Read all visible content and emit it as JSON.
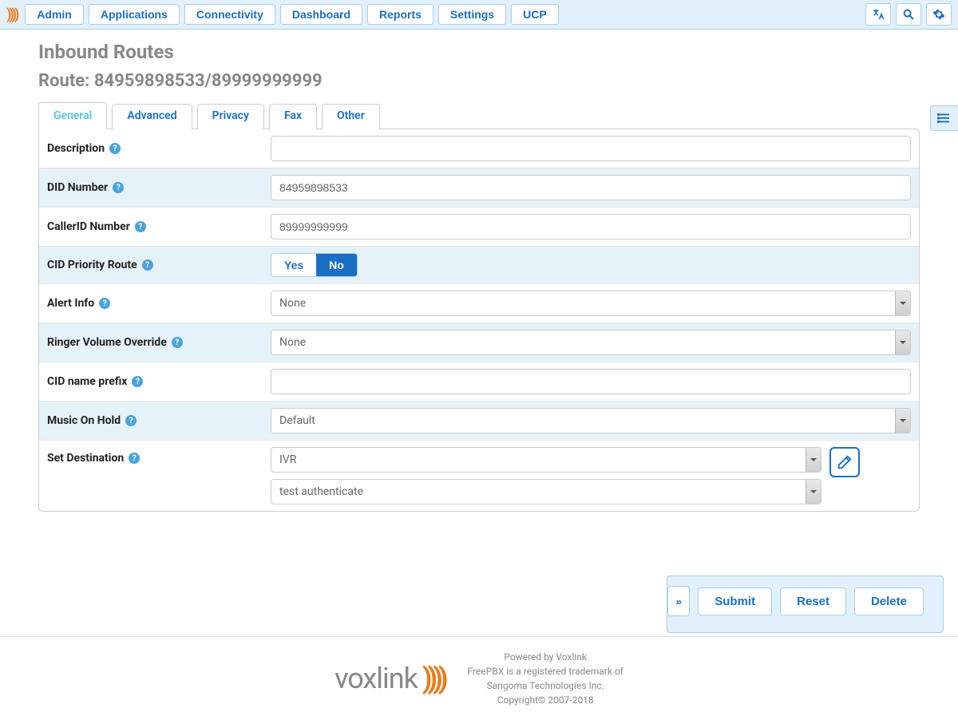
{
  "nav": {
    "items": [
      "Admin",
      "Applications",
      "Connectivity",
      "Dashboard",
      "Reports",
      "Settings",
      "UCP"
    ]
  },
  "page": {
    "title": "Inbound Routes",
    "route_label": "Route: 84959898533/89999999999"
  },
  "tabs": [
    "General",
    "Advanced",
    "Privacy",
    "Fax",
    "Other"
  ],
  "form": {
    "description": {
      "label": "Description",
      "value": ""
    },
    "did": {
      "label": "DID Number",
      "value": "84959898533"
    },
    "cid": {
      "label": "CallerID Number",
      "value": "89999999999"
    },
    "cid_priority": {
      "label": "CID Priority Route",
      "yes": "Yes",
      "no": "No",
      "value": "No"
    },
    "alert_info": {
      "label": "Alert Info",
      "value": "None"
    },
    "ringer_vol": {
      "label": "Ringer Volume Override",
      "value": "None"
    },
    "cid_prefix": {
      "label": "CID name prefix",
      "value": ""
    },
    "moh": {
      "label": "Music On Hold",
      "value": "Default"
    },
    "dest": {
      "label": "Set Destination",
      "value1": "IVR",
      "value2": "test authenticate"
    }
  },
  "buttons": {
    "submit": "Submit",
    "reset": "Reset",
    "delete": "Delete"
  },
  "footer": {
    "brand": "voxlink",
    "l1": "Powered by Voxlink",
    "l2": "FreePBX is a registered trademark of",
    "l3": "Sangoma Technologies Inc.",
    "l4": "Copyright© 2007-2018"
  }
}
